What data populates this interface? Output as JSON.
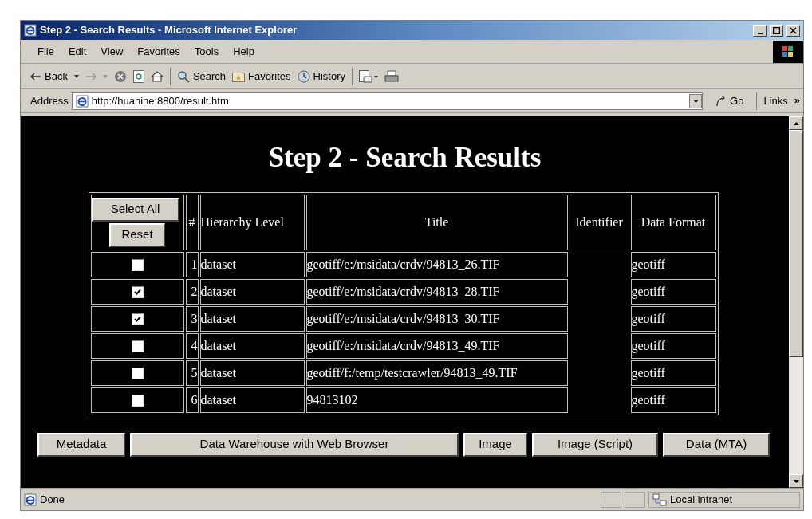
{
  "window": {
    "title": "Step 2 - Search Results - Microsoft Internet Explorer"
  },
  "menu": [
    "File",
    "Edit",
    "View",
    "Favorites",
    "Tools",
    "Help"
  ],
  "toolbar": {
    "back": "Back",
    "search": "Search",
    "favorites": "Favorites",
    "history": "History"
  },
  "address_bar": {
    "label": "Address",
    "url": "http://huahine:8800/result.htm",
    "go": "Go",
    "links": "Links",
    "more": "»"
  },
  "page": {
    "heading": "Step 2 - Search Results",
    "header_buttons": [
      "Select All",
      "Reset"
    ],
    "columns": [
      "#",
      "Hierarchy Level",
      "Title",
      "Identifier",
      "Data Format"
    ],
    "rows": [
      {
        "checked": false,
        "number": "1",
        "hierarchy_level": "dataset",
        "title": "geotiff/e:/msidata/crdv/94813_26.TIF",
        "data_format": "geotiff"
      },
      {
        "checked": true,
        "number": "2",
        "hierarchy_level": "dataset",
        "title": "geotiff/e:/msidata/crdv/94813_28.TIF",
        "data_format": "geotiff"
      },
      {
        "checked": true,
        "number": "3",
        "hierarchy_level": "dataset",
        "title": "geotiff/e:/msidata/crdv/94813_30.TIF",
        "data_format": "geotiff"
      },
      {
        "checked": false,
        "number": "4",
        "hierarchy_level": "dataset",
        "title": "geotiff/e:/msidata/crdv/94813_49.TIF",
        "data_format": "geotiff"
      },
      {
        "checked": false,
        "number": "5",
        "hierarchy_level": "dataset",
        "title": "geotiff/f:/temp/testcrawler/94813_49.TIF",
        "data_format": "geotiff"
      },
      {
        "checked": false,
        "number": "6",
        "hierarchy_level": "dataset",
        "title": "94813102",
        "data_format": "geotiff"
      }
    ],
    "action_buttons": [
      "Metadata",
      "Data Warehouse with Web Browser",
      "Image",
      "Image (Script)",
      "Data (MTA)"
    ]
  },
  "status_bar": {
    "text": "Done",
    "zone": "Local intranet"
  }
}
